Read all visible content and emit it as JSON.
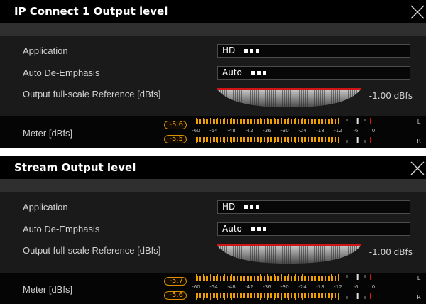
{
  "colors": {
    "accent": "#d11414",
    "peak": "#f0a000",
    "meter_bar": "#f0a000"
  },
  "panels": [
    {
      "title": "IP Connect 1 Output level",
      "close_icon": "close-x-icon",
      "application_label": "Application",
      "application_value": "HD",
      "deemphasis_label": "Auto De-Emphasis",
      "deemphasis_value": "Auto",
      "reference_label": "Output full-scale Reference [dBfs]",
      "reference_value": "-1.00 dBfs",
      "meter_label": "Meter [dBfs]",
      "peak_left": "-5.6",
      "peak_right": "-5.5",
      "scale": [
        "-60",
        "-54",
        "-48",
        "-42",
        "-36",
        "-30",
        "-24",
        "-18",
        "-12",
        "-6",
        "0"
      ],
      "channel_left": "L",
      "channel_right": "R"
    },
    {
      "title": "Stream Output level",
      "close_icon": "close-x-icon",
      "application_label": "Application",
      "application_value": "HD",
      "deemphasis_label": "Auto De-Emphasis",
      "deemphasis_value": "Auto",
      "reference_label": "Output full-scale Reference [dBfs]",
      "reference_value": "-1.00 dBfs",
      "meter_label": "Meter [dBfs]",
      "peak_left": "-5.7",
      "peak_right": "-5.6",
      "scale": [
        "-60",
        "-54",
        "-48",
        "-42",
        "-36",
        "-30",
        "-24",
        "-18",
        "-12",
        "-6",
        "0"
      ],
      "channel_left": "L",
      "channel_right": "R"
    }
  ]
}
